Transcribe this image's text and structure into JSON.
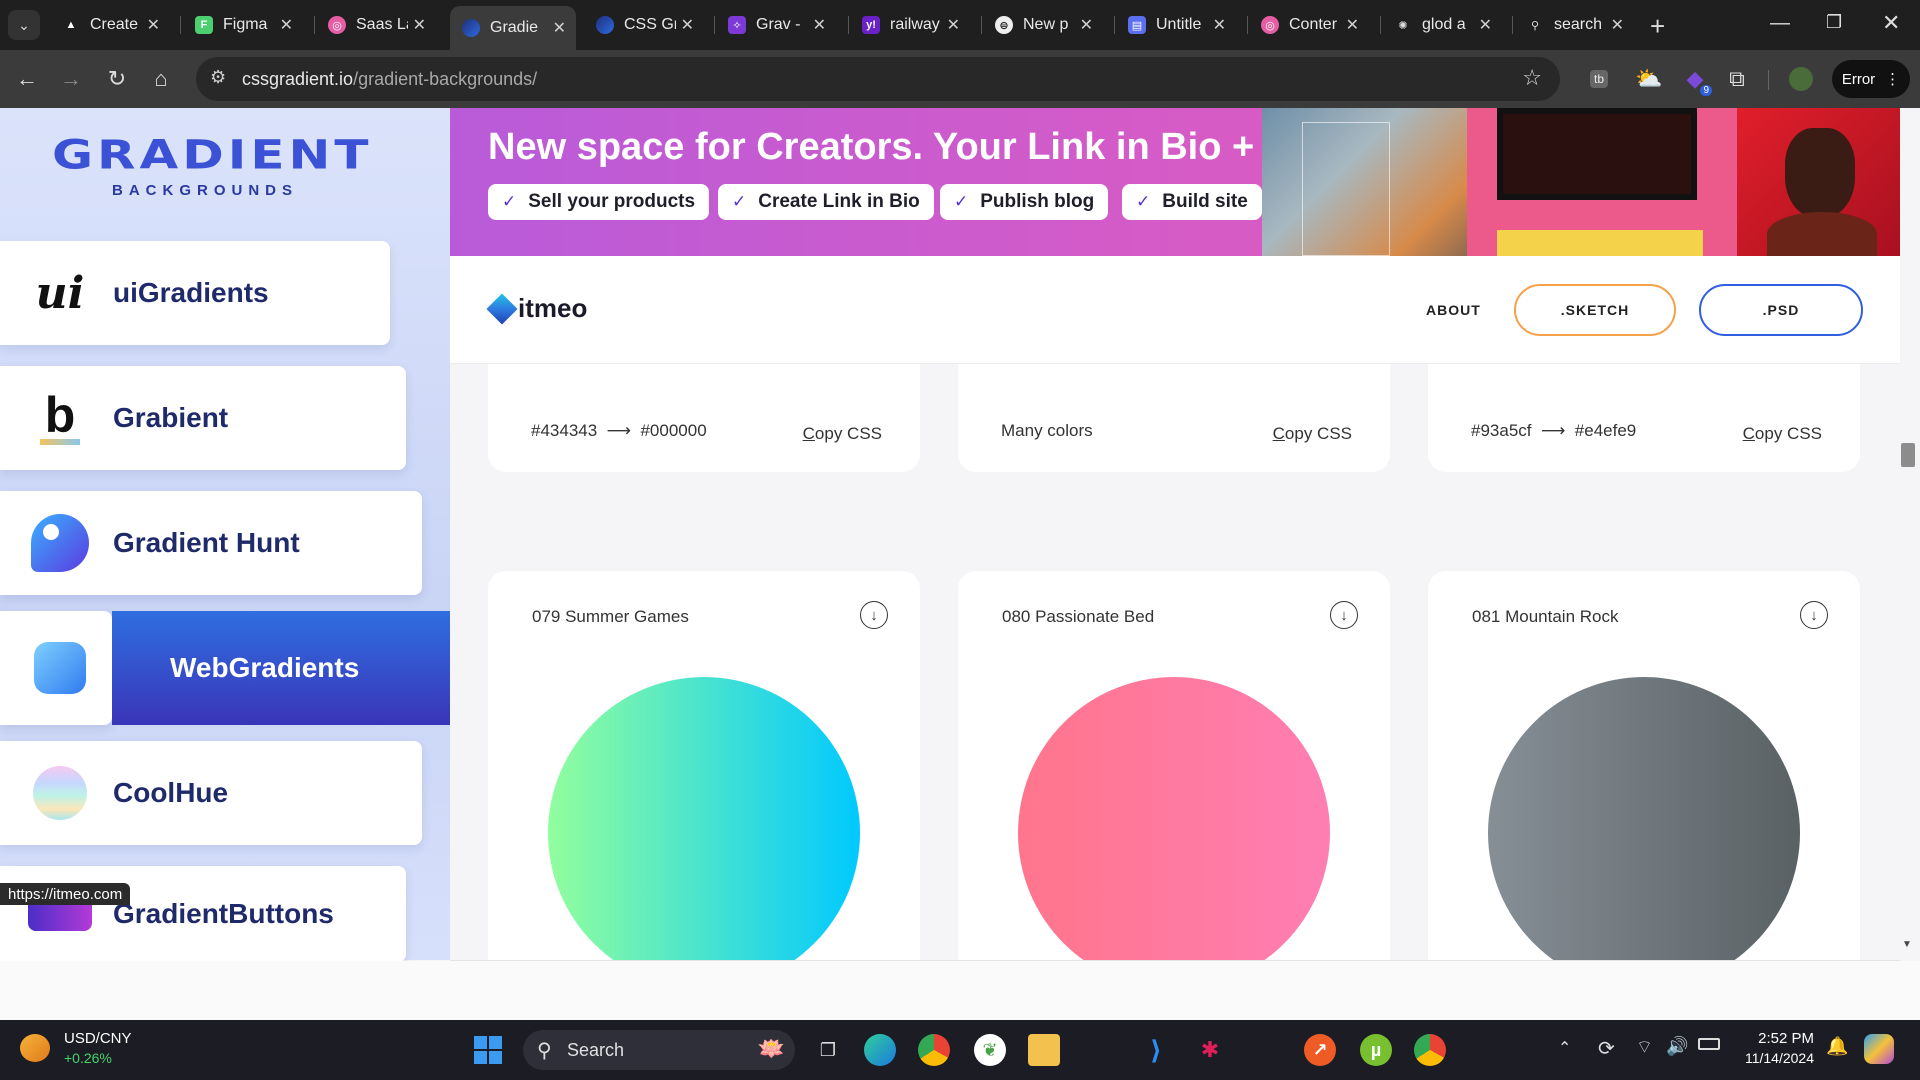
{
  "browser": {
    "tabs": [
      {
        "label": "Create",
        "icon": "drive-icon",
        "color": "#f2c14e"
      },
      {
        "label": "Figma",
        "icon": "figma-icon",
        "color": "#4ccf6f"
      },
      {
        "label": "Saas La",
        "icon": "dribbble-icon",
        "color": "#e55ea4"
      },
      {
        "label": "Gradie",
        "icon": "gradient-icon",
        "color": "#2d6be0",
        "active": true
      },
      {
        "label": "CSS Gr",
        "icon": "gradient-icon",
        "color": "#2d6be0"
      },
      {
        "label": "Grav -",
        "icon": "grav-icon",
        "color": "#7b3ad6"
      },
      {
        "label": "railway",
        "icon": "yahoo-icon",
        "color": "#6b21c8"
      },
      {
        "label": "New p",
        "icon": "new-page-icon",
        "color": "#f0f0f0"
      },
      {
        "label": "Untitle",
        "icon": "window-icon",
        "color": "#5b6ff0"
      },
      {
        "label": "Conter",
        "icon": "dribbble-icon",
        "color": "#e55ea4"
      },
      {
        "label": "glod a",
        "icon": "openai-icon",
        "color": "#cfcfcf"
      },
      {
        "label": "search",
        "icon": "search-favicon-icon",
        "color": "#cfcfcf"
      }
    ],
    "url": {
      "host": "cssgradient.io",
      "path": "/gradient-backgrounds/"
    },
    "profile_button": "Error",
    "extension_badge": "9"
  },
  "sidebar": {
    "logo_word": "GRADIENT",
    "logo_sub": "BACKGROUNDS",
    "items": [
      {
        "label": "uiGradients",
        "icon": "uigradients-logo-icon"
      },
      {
        "label": "Grabient",
        "icon": "grabient-logo-icon"
      },
      {
        "label": "Gradient Hunt",
        "icon": "gradient-hunt-logo-icon"
      },
      {
        "label": "WebGradients",
        "icon": "webgradients-logo-icon",
        "active": true
      },
      {
        "label": "CoolHue",
        "icon": "coolhue-logo-icon"
      },
      {
        "label": "GradientButtons",
        "icon": "gradientbuttons-logo-icon"
      }
    ]
  },
  "promo": {
    "title": "New space for Creators. Your Link in Bio + Market.",
    "pills": [
      "Sell your products",
      "Create Link in Bio",
      "Publish blog",
      "Build site"
    ]
  },
  "header": {
    "brand": "itmeo",
    "nav_about": "ABOUT",
    "btn_sketch": ".SKETCH",
    "btn_psd": ".PSD"
  },
  "cards_top": [
    {
      "from": "#434343",
      "to": "#000000",
      "arrow": "⟶",
      "copy": "Copy CSS"
    },
    {
      "colors_text": "Many colors",
      "copy": "Copy CSS"
    },
    {
      "from": "#93a5cf",
      "to": "#e4efe9",
      "arrow": "⟶",
      "copy": "Copy CSS"
    }
  ],
  "cards_bottom": [
    {
      "name": "079 Summer Games",
      "gradient_from": "#92fe9d",
      "gradient_to": "#00c9ff"
    },
    {
      "name": "080 Passionate Bed",
      "gradient_from": "#ff758c",
      "gradient_to": "#ff7eb3"
    },
    {
      "name": "081 Mountain Rock",
      "gradient_from": "#868f96",
      "gradient_to": "#596164"
    }
  ],
  "status_link": "https://itmeo.com",
  "taskbar": {
    "widget_title": "USD/CNY",
    "widget_value": "+0.26%",
    "search_label": "Search",
    "time": "2:52 PM",
    "date": "11/14/2024"
  }
}
